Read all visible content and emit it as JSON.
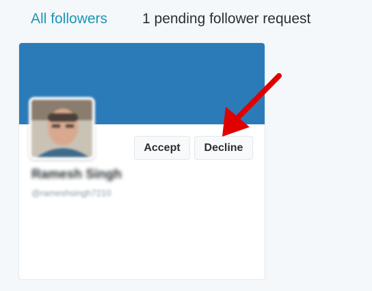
{
  "tabs": {
    "all_followers": "All followers",
    "pending": "1 pending follower request"
  },
  "request": {
    "display_name": "Ramesh Singh",
    "handle": "@rameshsingh7210",
    "accept_label": "Accept",
    "decline_label": "Decline"
  },
  "colors": {
    "accent": "#1b95b5",
    "banner": "#2b7bb9",
    "annotation_arrow": "#e00000"
  }
}
